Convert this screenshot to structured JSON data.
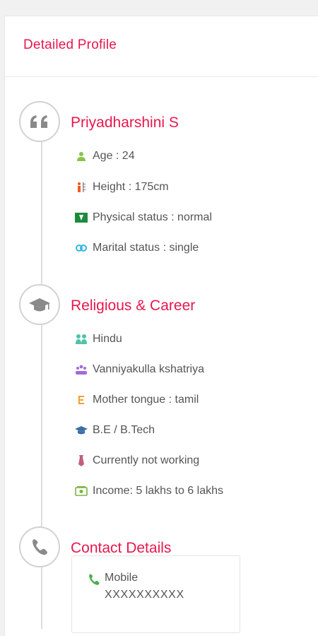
{
  "card": {
    "title": "Detailed Profile"
  },
  "profile": {
    "name": "Priyadharshini S",
    "items": [
      {
        "icon": "person-icon",
        "color": "#8bc34a",
        "label": "Age : 24"
      },
      {
        "icon": "height-icon",
        "color": "#f15a24",
        "label": "Height : 175cm"
      },
      {
        "icon": "physical-status-icon",
        "color": "#1e8a3c",
        "label": "Physical status : normal"
      },
      {
        "icon": "rings-icon",
        "color": "#33b5e5",
        "label": "Marital status : single"
      }
    ]
  },
  "religious": {
    "title": "Religious & Career",
    "items": [
      {
        "icon": "religion-icon",
        "color": "#4fc3a7",
        "label": "Hindu"
      },
      {
        "icon": "community-icon",
        "color": "#a26bd8",
        "label": "Vanniyakulla kshatriya"
      },
      {
        "icon": "language-icon",
        "color": "#f0a030",
        "label": "Mother tongue : tamil"
      },
      {
        "icon": "graduation-cap-icon",
        "color": "#3b6ea5",
        "label": "B.E / B.Tech"
      },
      {
        "icon": "tie-icon",
        "color": "#c0607a",
        "label": "Currently not working"
      },
      {
        "icon": "income-icon",
        "color": "#7cb342",
        "label": "Income: 5 lakhs to 6 lakhs"
      }
    ]
  },
  "contact": {
    "title": "Contact Details",
    "mobile_label": "Mobile",
    "mobile_value": "XXXXXXXXXX"
  },
  "colors": {
    "accent": "#e8174d",
    "text": "#555555",
    "icon_ring": "#d2d2d2"
  }
}
